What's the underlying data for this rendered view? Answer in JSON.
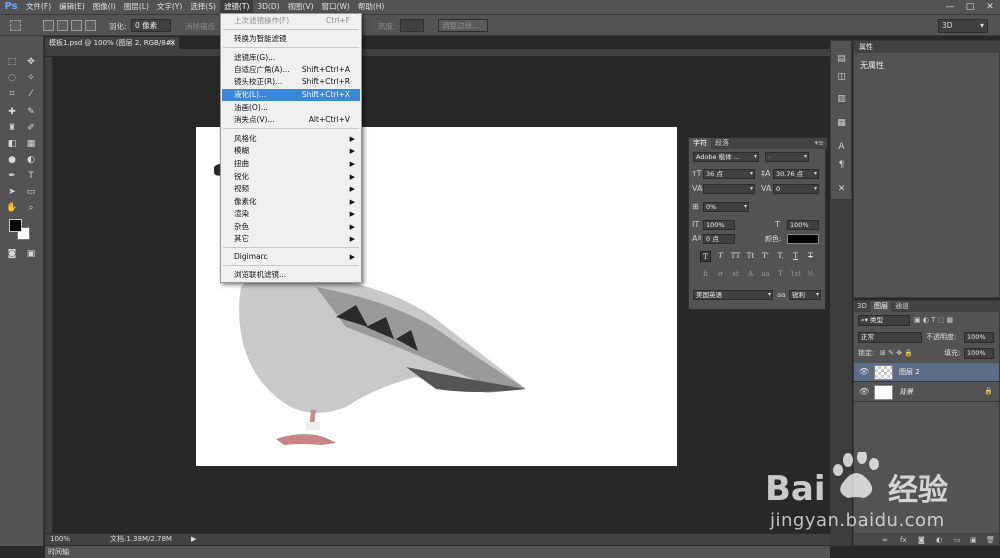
{
  "app": {
    "logo": "Ps",
    "menus": [
      "文件(F)",
      "编辑(E)",
      "图像(I)",
      "图层(L)",
      "文字(Y)",
      "选择(S)",
      "滤镜(T)",
      "3D(D)",
      "视图(V)",
      "窗口(W)",
      "帮助(H)"
    ],
    "window_controls": [
      "—",
      "□",
      "✕"
    ]
  },
  "options_bar": {
    "feather_label": "羽化:",
    "feather_value": "0 像素",
    "antialias_label": "消除锯齿",
    "height_label": "高度:",
    "refine_edge": "调整边缘...",
    "workspace": "3D"
  },
  "document": {
    "tab_title": "模板1.psd @ 100% (图层 2, RGB/8#)",
    "tab_close": "×",
    "zoom": "100%",
    "doc_info": "文档:1.38M/2.78M",
    "status_arrow": "▶",
    "timeline_label": "时间轴"
  },
  "filter_menu": {
    "items": [
      {
        "label": "上次滤镜操作(F)",
        "shortcut": "Ctrl+F",
        "disabled": true
      },
      {
        "label": "转换为智能滤镜",
        "shortcut": ""
      },
      {
        "label": "滤镜库(G)...",
        "shortcut": ""
      },
      {
        "label": "自适应广角(A)...",
        "shortcut": "Shift+Ctrl+A"
      },
      {
        "label": "镜头校正(R)...",
        "shortcut": "Shift+Ctrl+R"
      },
      {
        "label": "液化(L)...",
        "shortcut": "Shift+Ctrl+X",
        "highlighted": true
      },
      {
        "label": "油画(O)...",
        "shortcut": ""
      },
      {
        "label": "消失点(V)...",
        "shortcut": "Alt+Ctrl+V"
      },
      {
        "label": "风格化",
        "submenu": true
      },
      {
        "label": "模糊",
        "submenu": true
      },
      {
        "label": "扭曲",
        "submenu": true
      },
      {
        "label": "锐化",
        "submenu": true
      },
      {
        "label": "视频",
        "submenu": true
      },
      {
        "label": "像素化",
        "submenu": true
      },
      {
        "label": "渲染",
        "submenu": true
      },
      {
        "label": "杂色",
        "submenu": true
      },
      {
        "label": "其它",
        "submenu": true
      },
      {
        "label": "Digimarc",
        "submenu": true
      },
      {
        "label": "浏览联机滤镜..."
      }
    ]
  },
  "properties_panel": {
    "tab": "属性",
    "content": "无属性"
  },
  "character_panel": {
    "tabs": [
      "字符",
      "段落"
    ],
    "font_family": "Adobe 楷体 ...",
    "font_style": "-",
    "size": "36 点",
    "leading": "30.76 点",
    "kerning": "",
    "tracking": "0",
    "scale_pct": "0%",
    "vertical_scale": "100%",
    "horizontal_scale": "100%",
    "baseline_shift": "0 点",
    "color_label": "颜色:",
    "styles_row1": [
      "T",
      "T",
      "TT",
      "Tt",
      "T'",
      "T,",
      "T",
      "T"
    ],
    "styles_row2": [
      "fi",
      "σ",
      "st",
      "A",
      "aa",
      "T",
      "1st",
      "½"
    ],
    "language": "美国英语",
    "antialias": "锐利"
  },
  "layers_panel": {
    "tabs": [
      "3D",
      "图层",
      "通道"
    ],
    "filter_kind": "类型",
    "blend_mode": "正常",
    "opacity_label": "不透明度:",
    "opacity": "100%",
    "lock_label": "锁定:",
    "fill_label": "填充:",
    "fill": "100%",
    "layers": [
      {
        "name": "图层 2",
        "selected": true,
        "italic": false
      },
      {
        "name": "背景",
        "selected": false,
        "italic": true
      }
    ]
  },
  "watermark": {
    "brand": "Bai 经验",
    "url": "jingyan.baidu.com"
  }
}
